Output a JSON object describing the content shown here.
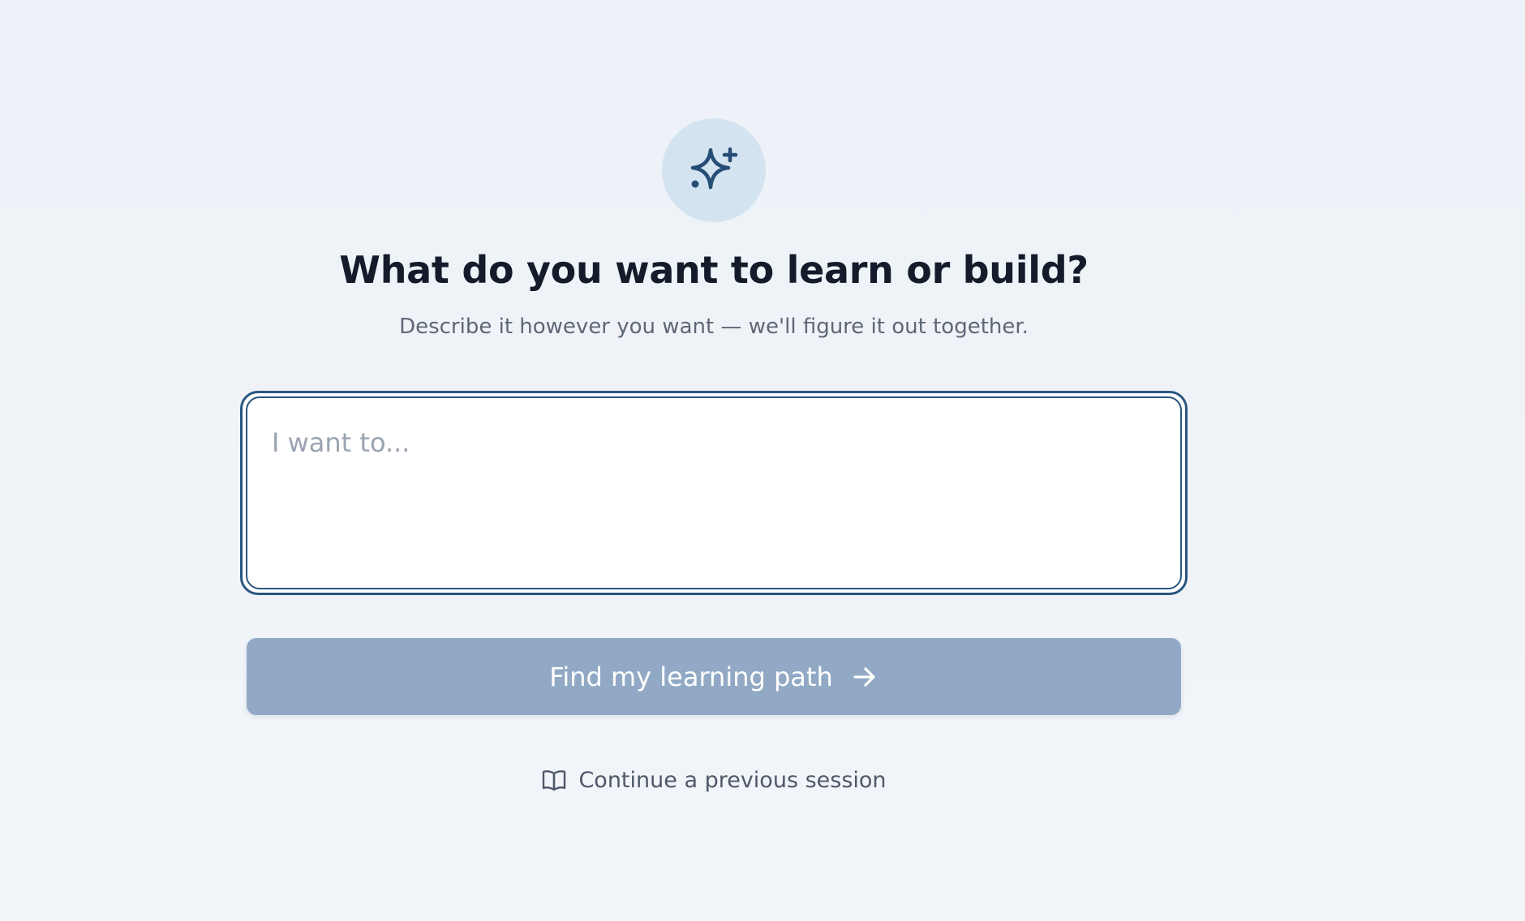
{
  "hero": {
    "icon": "sparkles-icon",
    "title": "What do you want to learn or build?",
    "subtitle": "Describe it however you want — we'll figure it out together."
  },
  "prompt_input": {
    "value": "",
    "placeholder": "I want to..."
  },
  "submit": {
    "label": "Find my learning path",
    "icon": "arrow-right-icon",
    "state": "disabled"
  },
  "continue_session": {
    "label": "Continue a previous session",
    "icon": "open-book-icon"
  },
  "colors": {
    "accent": "#2a5680",
    "button_disabled": "#91a9c4",
    "icon_circle": "#d3e3f0",
    "heading": "#141b2a",
    "muted_text": "#5e6776"
  }
}
